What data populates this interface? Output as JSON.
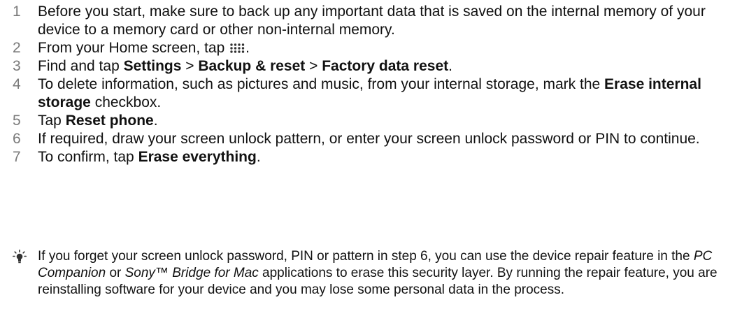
{
  "steps": [
    {
      "num": "1",
      "parts": [
        {
          "t": "Before you start, make sure to back up any important data that is saved on the internal memory of your device to a memory card or other non-internal memory."
        }
      ]
    },
    {
      "num": "2",
      "parts": [
        {
          "t": "From your Home screen, tap "
        },
        {
          "icon": "apps-grid-icon"
        },
        {
          "t": "."
        }
      ]
    },
    {
      "num": "3",
      "parts": [
        {
          "t": "Find and tap "
        },
        {
          "b": "Settings"
        },
        {
          "t": " > "
        },
        {
          "b": "Backup & reset"
        },
        {
          "t": " > "
        },
        {
          "b": "Factory data reset"
        },
        {
          "t": "."
        }
      ]
    },
    {
      "num": "4",
      "parts": [
        {
          "t": "To delete information, such as pictures and music, from your internal storage, mark the "
        },
        {
          "b": "Erase internal storage"
        },
        {
          "t": " checkbox."
        }
      ]
    },
    {
      "num": "5",
      "parts": [
        {
          "t": "Tap "
        },
        {
          "b": "Reset phone"
        },
        {
          "t": "."
        }
      ]
    },
    {
      "num": "6",
      "parts": [
        {
          "t": "If required, draw your screen unlock pattern, or enter your screen unlock password or PIN to continue."
        }
      ]
    },
    {
      "num": "7",
      "parts": [
        {
          "t": "To confirm, tap "
        },
        {
          "b": "Erase everything"
        },
        {
          "t": "."
        }
      ]
    }
  ],
  "tip": {
    "icon": "lightbulb-icon",
    "parts": [
      {
        "t": "If you forget your screen unlock password, PIN or pattern in step 6, you can use the device repair feature in the "
      },
      {
        "i": "PC Companion"
      },
      {
        "t": " or "
      },
      {
        "i": "Sony™ Bridge for Mac"
      },
      {
        "t": " applications to erase this security layer. By running the repair feature, you are reinstalling software for your device and you may lose some personal data in the process."
      }
    ]
  }
}
